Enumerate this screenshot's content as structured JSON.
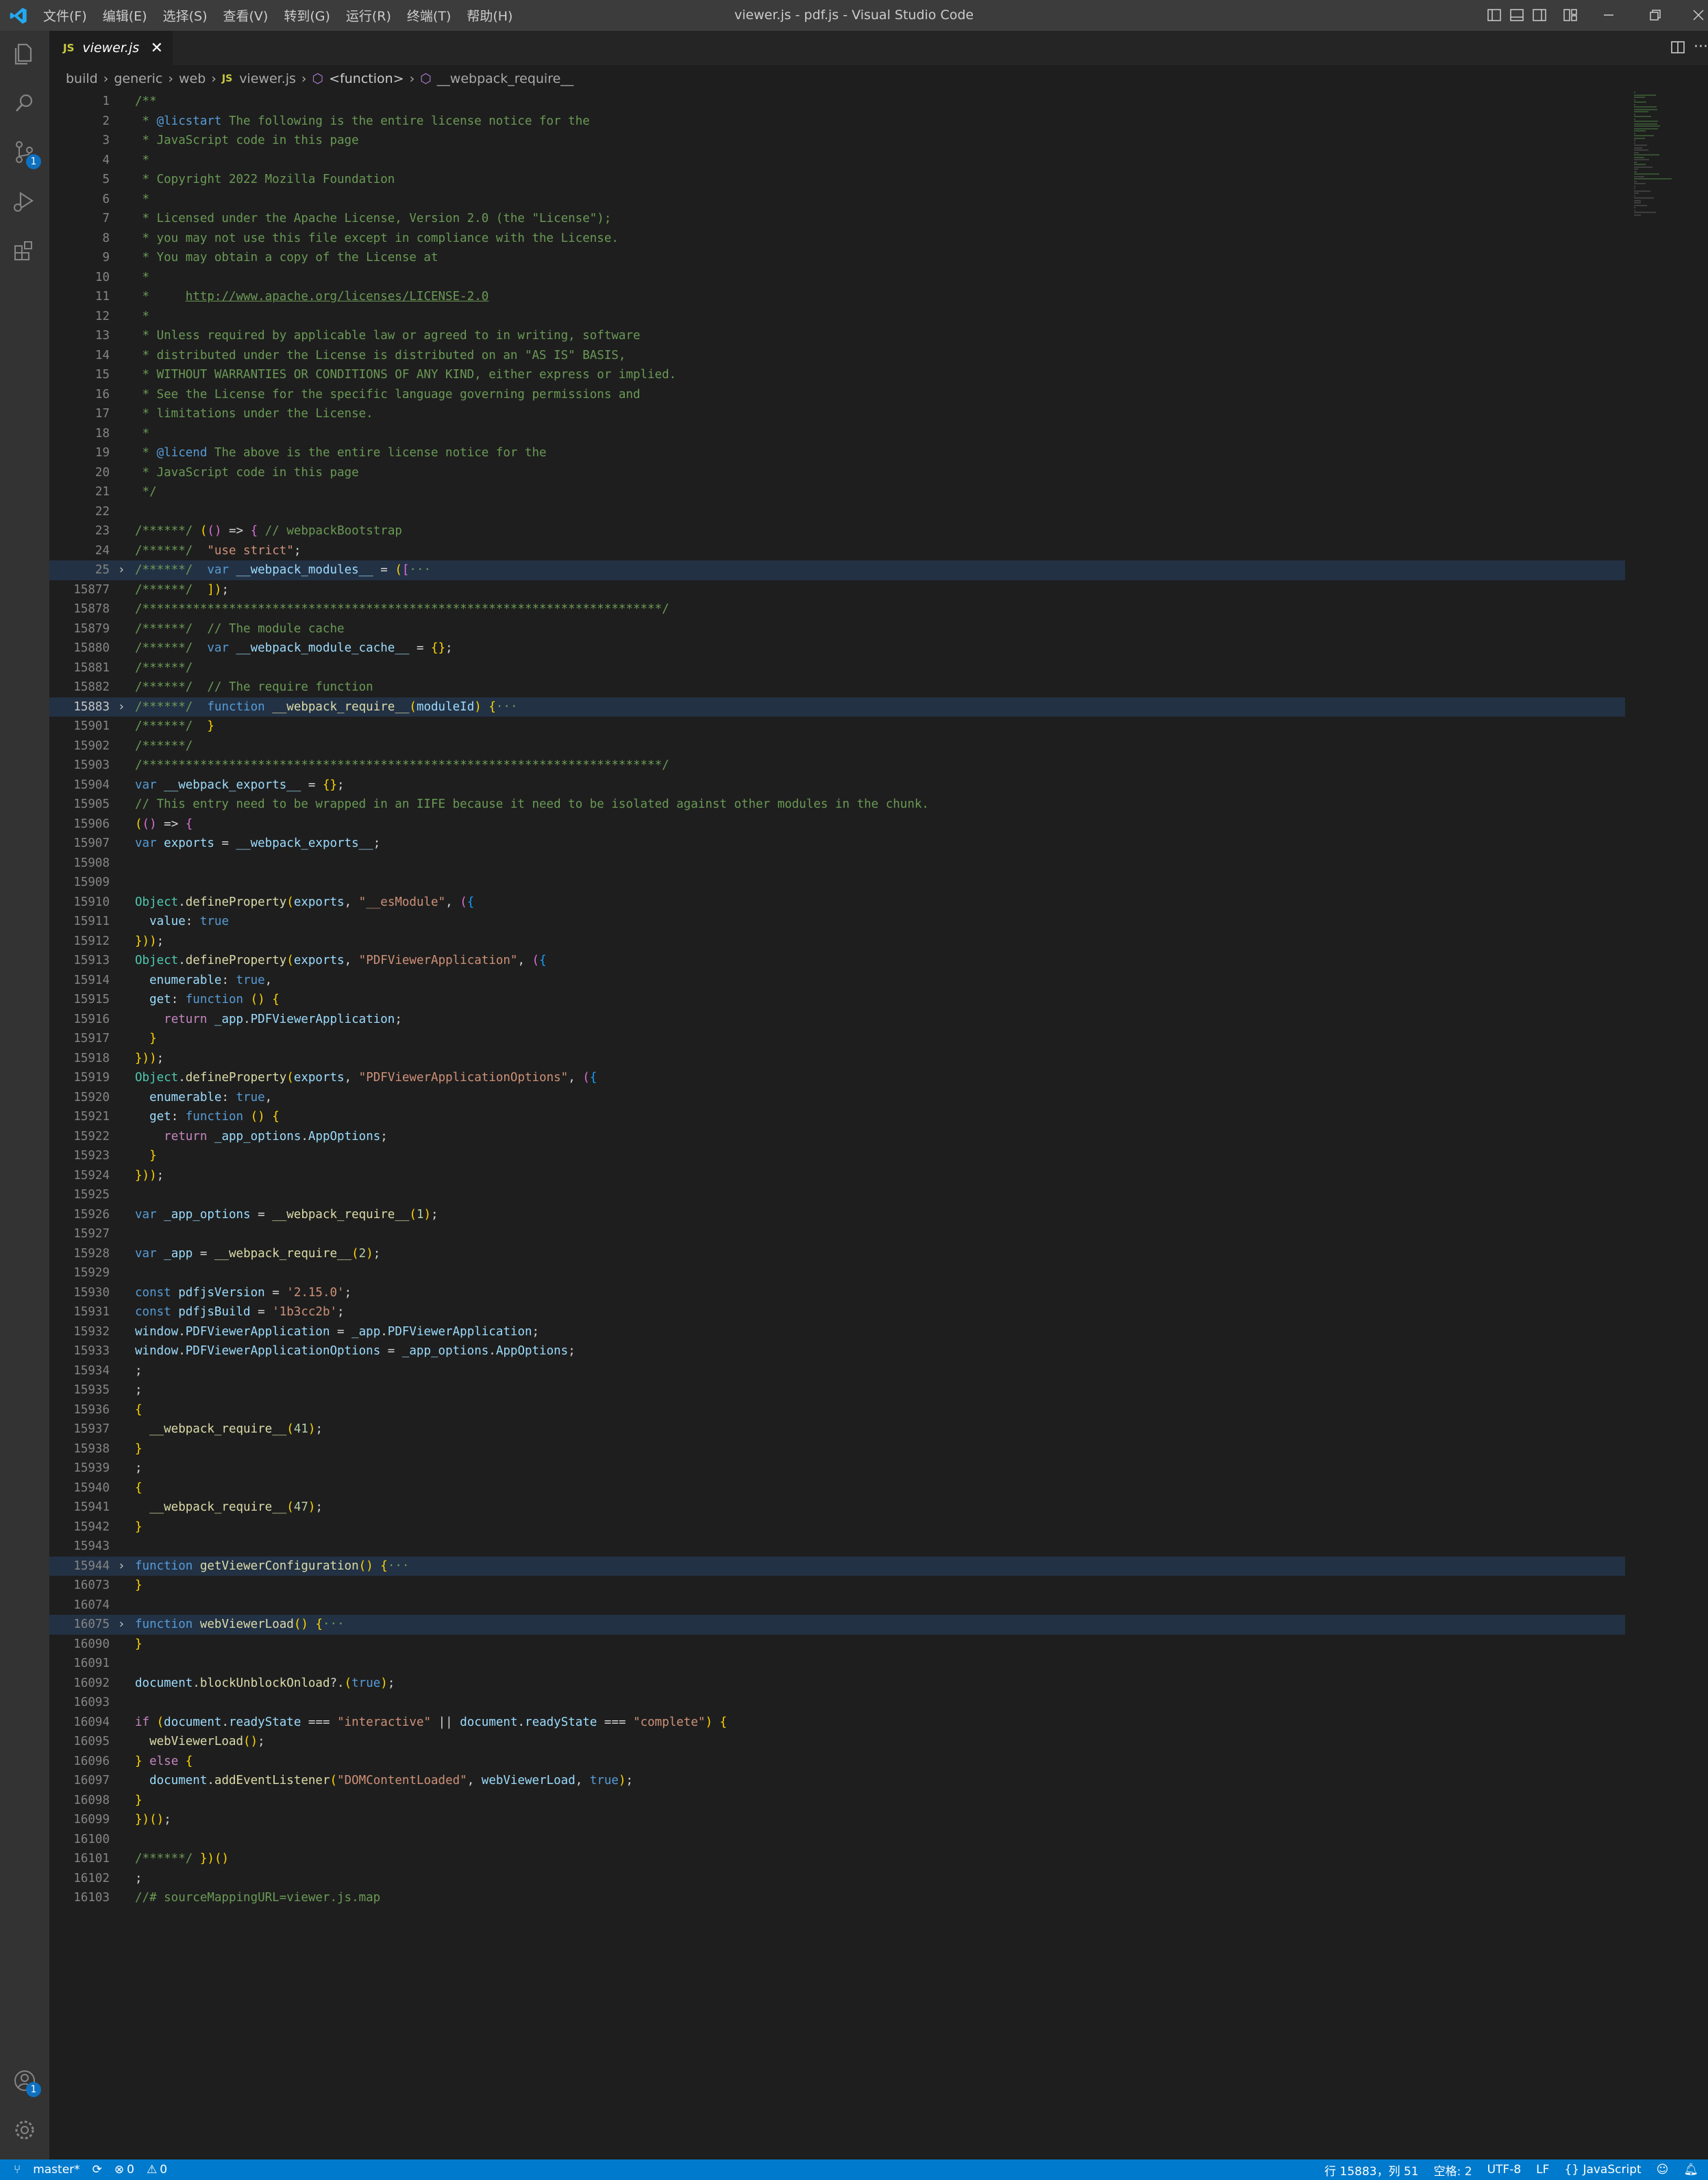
{
  "titlebar": {
    "menu": [
      "文件(F)",
      "编辑(E)",
      "选择(S)",
      "查看(V)",
      "转到(G)",
      "运行(R)",
      "终端(T)",
      "帮助(H)"
    ],
    "title": "viewer.js - pdf.js - Visual Studio Code"
  },
  "activity": {
    "scm_badge": "1",
    "account_badge": "1"
  },
  "tab": {
    "icon": "JS",
    "name": "viewer.js"
  },
  "breadcrumb": {
    "items": [
      "build",
      "generic",
      "web",
      "viewer.js",
      "<function>",
      "__webpack_require__"
    ],
    "file_icon": "JS"
  },
  "editor": {
    "current_line": "15883",
    "lines": [
      {
        "ln": "1",
        "code": "/**",
        "type": "comment"
      },
      {
        "ln": "2",
        "code": " * @licstart The following is the entire license notice for the",
        "type": "comment"
      },
      {
        "ln": "3",
        "code": " * JavaScript code in this page",
        "type": "comment"
      },
      {
        "ln": "4",
        "code": " *",
        "type": "comment"
      },
      {
        "ln": "5",
        "code": " * Copyright 2022 Mozilla Foundation",
        "type": "comment"
      },
      {
        "ln": "6",
        "code": " *",
        "type": "comment"
      },
      {
        "ln": "7",
        "code": " * Licensed under the Apache License, Version 2.0 (the \"License\");",
        "type": "comment"
      },
      {
        "ln": "8",
        "code": " * you may not use this file except in compliance with the License.",
        "type": "comment"
      },
      {
        "ln": "9",
        "code": " * You may obtain a copy of the License at",
        "type": "comment"
      },
      {
        "ln": "10",
        "code": " *",
        "type": "comment"
      },
      {
        "ln": "11",
        "code": " *     http://www.apache.org/licenses/LICENSE-2.0",
        "type": "comment"
      },
      {
        "ln": "12",
        "code": " *",
        "type": "comment"
      },
      {
        "ln": "13",
        "code": " * Unless required by applicable law or agreed to in writing, software",
        "type": "comment"
      },
      {
        "ln": "14",
        "code": " * distributed under the License is distributed on an \"AS IS\" BASIS,",
        "type": "comment"
      },
      {
        "ln": "15",
        "code": " * WITHOUT WARRANTIES OR CONDITIONS OF ANY KIND, either express or implied.",
        "type": "comment"
      },
      {
        "ln": "16",
        "code": " * See the License for the specific language governing permissions and",
        "type": "comment"
      },
      {
        "ln": "17",
        "code": " * limitations under the License.",
        "type": "comment"
      },
      {
        "ln": "18",
        "code": " *",
        "type": "comment"
      },
      {
        "ln": "19",
        "code": " * @licend The above is the entire license notice for the",
        "type": "comment"
      },
      {
        "ln": "20",
        "code": " * JavaScript code in this page",
        "type": "comment"
      },
      {
        "ln": "21",
        "code": " */",
        "type": "comment"
      },
      {
        "ln": "22",
        "code": "",
        "type": "plain"
      },
      {
        "ln": "23",
        "code": "/******/ (() => { // webpackBootstrap",
        "type": "mixed"
      },
      {
        "ln": "24",
        "code": "/******/  \"use strict\";",
        "type": "mixed"
      },
      {
        "ln": "25",
        "code": "/******/  var __webpack_modules__ = ([···",
        "type": "mixed",
        "folded": true
      },
      {
        "ln": "15877",
        "code": "/******/  ]);",
        "type": "mixed"
      },
      {
        "ln": "15878",
        "code": "/************************************************************************/",
        "type": "comment"
      },
      {
        "ln": "15879",
        "code": "/******/  // The module cache",
        "type": "comment"
      },
      {
        "ln": "15880",
        "code": "/******/  var __webpack_module_cache__ = {};",
        "type": "mixed"
      },
      {
        "ln": "15881",
        "code": "/******/",
        "type": "comment"
      },
      {
        "ln": "15882",
        "code": "/******/  // The require function",
        "type": "comment"
      },
      {
        "ln": "15883",
        "code": "/******/  function __webpack_require__(moduleId) {···",
        "type": "mixed",
        "folded": true,
        "current": true
      },
      {
        "ln": "15901",
        "code": "/******/  }",
        "type": "mixed"
      },
      {
        "ln": "15902",
        "code": "/******/",
        "type": "comment"
      },
      {
        "ln": "15903",
        "code": "/************************************************************************/",
        "type": "comment"
      },
      {
        "ln": "15904",
        "code": "var __webpack_exports__ = {};",
        "type": "code"
      },
      {
        "ln": "15905",
        "code": "// This entry need to be wrapped in an IIFE because it need to be isolated against other modules in the chunk.",
        "type": "comment"
      },
      {
        "ln": "15906",
        "code": "(() => {",
        "type": "code"
      },
      {
        "ln": "15907",
        "code": "var exports = __webpack_exports__;",
        "type": "code"
      },
      {
        "ln": "15908",
        "code": "",
        "type": "plain"
      },
      {
        "ln": "15909",
        "code": "",
        "type": "plain"
      },
      {
        "ln": "15910",
        "code": "Object.defineProperty(exports, \"__esModule\", ({",
        "type": "code"
      },
      {
        "ln": "15911",
        "code": "  value: true",
        "type": "code"
      },
      {
        "ln": "15912",
        "code": "}));",
        "type": "code"
      },
      {
        "ln": "15913",
        "code": "Object.defineProperty(exports, \"PDFViewerApplication\", ({",
        "type": "code"
      },
      {
        "ln": "15914",
        "code": "  enumerable: true,",
        "type": "code"
      },
      {
        "ln": "15915",
        "code": "  get: function () {",
        "type": "code"
      },
      {
        "ln": "15916",
        "code": "    return _app.PDFViewerApplication;",
        "type": "code"
      },
      {
        "ln": "15917",
        "code": "  }",
        "type": "code"
      },
      {
        "ln": "15918",
        "code": "}));",
        "type": "code"
      },
      {
        "ln": "15919",
        "code": "Object.defineProperty(exports, \"PDFViewerApplicationOptions\", ({",
        "type": "code"
      },
      {
        "ln": "15920",
        "code": "  enumerable: true,",
        "type": "code"
      },
      {
        "ln": "15921",
        "code": "  get: function () {",
        "type": "code"
      },
      {
        "ln": "15922",
        "code": "    return _app_options.AppOptions;",
        "type": "code"
      },
      {
        "ln": "15923",
        "code": "  }",
        "type": "code"
      },
      {
        "ln": "15924",
        "code": "}));",
        "type": "code"
      },
      {
        "ln": "15925",
        "code": "",
        "type": "plain"
      },
      {
        "ln": "15926",
        "code": "var _app_options = __webpack_require__(1);",
        "type": "code"
      },
      {
        "ln": "15927",
        "code": "",
        "type": "plain"
      },
      {
        "ln": "15928",
        "code": "var _app = __webpack_require__(2);",
        "type": "code"
      },
      {
        "ln": "15929",
        "code": "",
        "type": "plain"
      },
      {
        "ln": "15930",
        "code": "const pdfjsVersion = '2.15.0';",
        "type": "code"
      },
      {
        "ln": "15931",
        "code": "const pdfjsBuild = '1b3cc2b';",
        "type": "code"
      },
      {
        "ln": "15932",
        "code": "window.PDFViewerApplication = _app.PDFViewerApplication;",
        "type": "code"
      },
      {
        "ln": "15933",
        "code": "window.PDFViewerApplicationOptions = _app_options.AppOptions;",
        "type": "code"
      },
      {
        "ln": "15934",
        "code": ";",
        "type": "code"
      },
      {
        "ln": "15935",
        "code": ";",
        "type": "code"
      },
      {
        "ln": "15936",
        "code": "{",
        "type": "code"
      },
      {
        "ln": "15937",
        "code": "  __webpack_require__(41);",
        "type": "code"
      },
      {
        "ln": "15938",
        "code": "}",
        "type": "code"
      },
      {
        "ln": "15939",
        "code": ";",
        "type": "code"
      },
      {
        "ln": "15940",
        "code": "{",
        "type": "code"
      },
      {
        "ln": "15941",
        "code": "  __webpack_require__(47);",
        "type": "code"
      },
      {
        "ln": "15942",
        "code": "}",
        "type": "code"
      },
      {
        "ln": "15943",
        "code": "",
        "type": "plain"
      },
      {
        "ln": "15944",
        "code": "function getViewerConfiguration() {···",
        "type": "code",
        "folded": true
      },
      {
        "ln": "16073",
        "code": "}",
        "type": "code"
      },
      {
        "ln": "16074",
        "code": "",
        "type": "plain"
      },
      {
        "ln": "16075",
        "code": "function webViewerLoad() {···",
        "type": "code",
        "folded": true
      },
      {
        "ln": "16090",
        "code": "}",
        "type": "code"
      },
      {
        "ln": "16091",
        "code": "",
        "type": "plain"
      },
      {
        "ln": "16092",
        "code": "document.blockUnblockOnload?.(true);",
        "type": "code"
      },
      {
        "ln": "16093",
        "code": "",
        "type": "plain"
      },
      {
        "ln": "16094",
        "code": "if (document.readyState === \"interactive\" || document.readyState === \"complete\") {",
        "type": "code"
      },
      {
        "ln": "16095",
        "code": "  webViewerLoad();",
        "type": "code"
      },
      {
        "ln": "16096",
        "code": "} else {",
        "type": "code"
      },
      {
        "ln": "16097",
        "code": "  document.addEventListener(\"DOMContentLoaded\", webViewerLoad, true);",
        "type": "code"
      },
      {
        "ln": "16098",
        "code": "}",
        "type": "code"
      },
      {
        "ln": "16099",
        "code": "})();",
        "type": "code"
      },
      {
        "ln": "16100",
        "code": "",
        "type": "plain"
      },
      {
        "ln": "16101",
        "code": "/******/ })()",
        "type": "mixed"
      },
      {
        "ln": "16102",
        "code": ";",
        "type": "code"
      },
      {
        "ln": "16103",
        "code": "//# sourceMappingURL=viewer.js.map",
        "type": "comment"
      }
    ]
  },
  "statusbar": {
    "branch": "master*",
    "errors": "0",
    "warnings": "0",
    "position": "行 15883，列 51",
    "indent": "空格: 2",
    "encoding": "UTF-8",
    "eol": "LF",
    "language": "{} JavaScript"
  },
  "colors": {
    "accent": "#007acc",
    "editor_bg": "#1e1e1e",
    "activity_bg": "#333333"
  }
}
